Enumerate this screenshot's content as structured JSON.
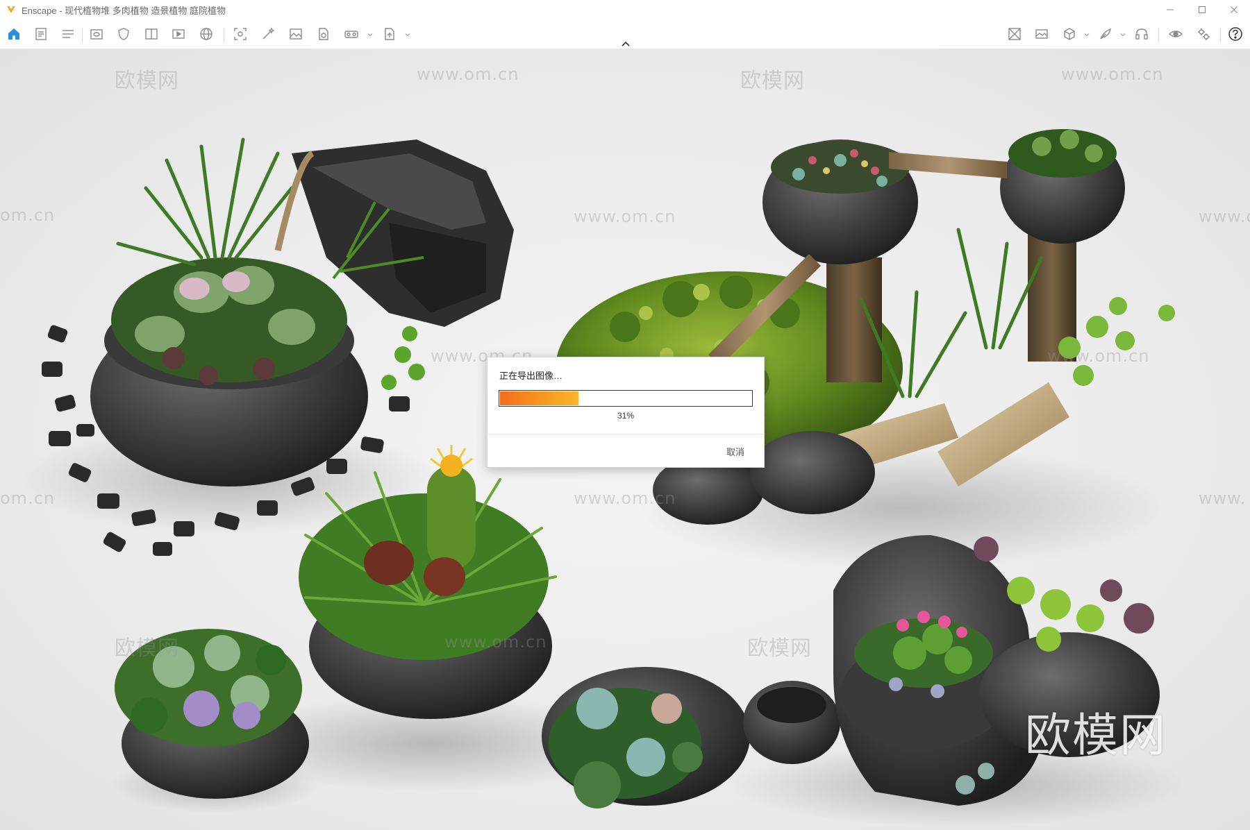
{
  "window": {
    "title": "Enscape - 现代植物堆 多肉植物 造景植物 庭院植物",
    "minimize_icon": "minimize-icon",
    "maximize_icon": "maximize-icon",
    "close_icon": "close-icon",
    "accent": "#f5a623"
  },
  "toolbar": {
    "left_icons": [
      "home-icon",
      "document-icon",
      "list-icon",
      "view-icon",
      "shield-icon",
      "book-icon",
      "video-icon",
      "panorama-icon",
      "screenshot-icon",
      "magic-wand-icon",
      "image-icon",
      "file-refresh-icon",
      "vr-headset-icon",
      "export-file-icon"
    ],
    "right_icons": [
      "asset-library-icon",
      "image-gallery-icon",
      "cube-icon",
      "feather-icon",
      "headset-icon",
      "eye-icon",
      "settings-icon",
      "help-icon"
    ],
    "home_color": "#2d8de0"
  },
  "viewport": {
    "watermarks": [
      "欧模网",
      "www.om.cn",
      "欧模网",
      "www.om.cn",
      "om.cn",
      "www.om.cn",
      "www.o",
      "www.om.cn",
      "www.om.cn",
      "om.cn",
      "www.om.cn",
      "www.",
      "欧模网",
      "www.om.cn",
      "欧模网"
    ],
    "brand_watermark": "欧模网"
  },
  "export_dialog": {
    "title": "正在导出图像…",
    "progress": 0.31,
    "percent_label": "31%",
    "cancel_label": "取消",
    "progress_color": "#f47a1c"
  }
}
